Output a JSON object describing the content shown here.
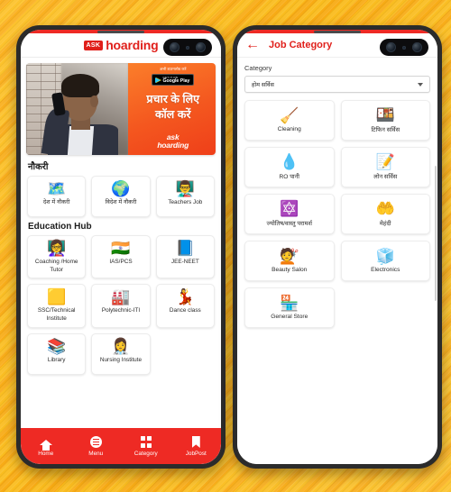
{
  "theme": {
    "brand_red": "#ee2a24",
    "accent_orange": "#f4571f",
    "background_yellow": "#fcbf22"
  },
  "left_phone": {
    "header": {
      "logo_badge": "ASK",
      "logo_text": "hoarding"
    },
    "banner": {
      "download_text": "अभी डाउनलोड करें",
      "store_badge_small": "GET IT ON",
      "store_badge_name": "Google Play",
      "headline_line1": "प्रचार के लिए",
      "headline_line2": "कॉल करें",
      "brand_line1": "ask",
      "brand_line2": "hoarding"
    },
    "sections": [
      {
        "title": "नौकरी",
        "cards": [
          {
            "icon": "🗺️",
            "label": "देश में नौकरी"
          },
          {
            "icon": "🌍",
            "label": "विदेश में नौकरी"
          },
          {
            "icon": "👨‍🏫",
            "label": "Teachers Job"
          }
        ]
      },
      {
        "title": "Education Hub",
        "cards": [
          {
            "icon": "👩‍🏫",
            "label": "Coaching /Home Tutor"
          },
          {
            "icon": "🇮🇳",
            "label": "IAS/PCS"
          },
          {
            "icon": "📘",
            "label": "JEE-NEET"
          },
          {
            "icon": "🟨",
            "label": "SSC/Technical Institute"
          },
          {
            "icon": "🏭",
            "label": "Polytechnic-ITI"
          },
          {
            "icon": "💃",
            "label": "Dance class"
          },
          {
            "icon": "📚",
            "label": "Library"
          },
          {
            "icon": "👩‍⚕️",
            "label": "Nursing Institute"
          }
        ]
      }
    ],
    "bottom_nav": [
      {
        "icon": "home-icon",
        "label": "Home"
      },
      {
        "icon": "menu-icon",
        "label": "Menu"
      },
      {
        "icon": "category-grid-icon",
        "label": "Category"
      },
      {
        "icon": "jobpost-bookmark-icon",
        "label": "JobPost"
      }
    ]
  },
  "right_phone": {
    "header": {
      "back_icon": "←",
      "title": "Job Category"
    },
    "form": {
      "label": "Category",
      "selected_value": "होम सर्विस",
      "dropdown_icon": "chevron-down-icon"
    },
    "cards": [
      {
        "icon": "🧹",
        "label": "Cleaning"
      },
      {
        "icon": "🍱",
        "label": "टिफिन सर्विस"
      },
      {
        "icon": "💧",
        "label": "RO पानी"
      },
      {
        "icon": "📝",
        "label": "लोन सर्विस"
      },
      {
        "icon": "🔯",
        "label": "ज्योतिष/वास्तु परामर्श"
      },
      {
        "icon": "🤲",
        "label": "मेहंदी"
      },
      {
        "icon": "💇",
        "label": "Beauty Salon"
      },
      {
        "icon": "🧊",
        "label": "Electronics"
      },
      {
        "icon": "🏪",
        "label": "General Store"
      }
    ]
  }
}
